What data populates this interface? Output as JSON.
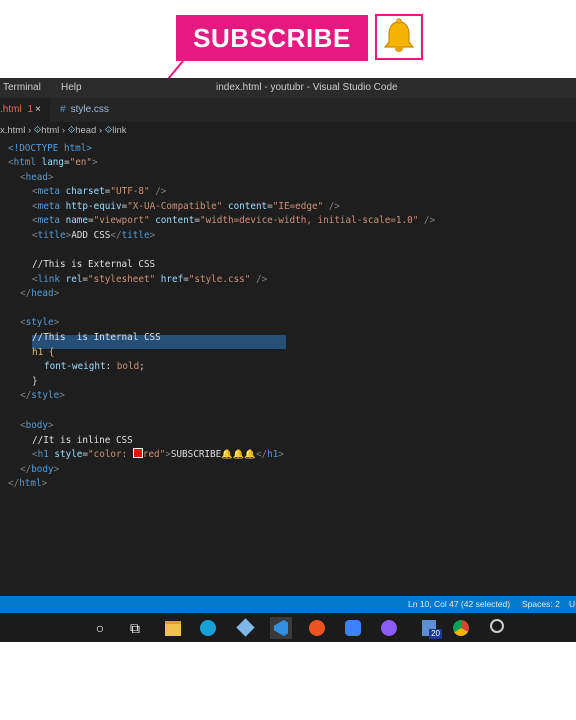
{
  "overlay": {
    "subscribe_label": "SUBSCRIBE",
    "bell_icon": "🔔"
  },
  "window": {
    "menu": [
      "Terminal",
      "Help"
    ],
    "title": "index.html - youtubr - Visual Studio Code"
  },
  "tabs": [
    {
      "label": ".html",
      "badge": "1",
      "close": "×",
      "active": true
    },
    {
      "label": "style.css",
      "prefix": "#",
      "active": false
    }
  ],
  "breadcrumb": [
    "x.html",
    "html",
    "head",
    "link"
  ],
  "code": {
    "doctype": "<!DOCTYPE html>",
    "title_text": "ADD CSS",
    "comment_external": "//This is External CSS",
    "comment_internal": "//This  is Internal CSS",
    "css_selector": "h1 {",
    "css_property": "font-weight",
    "css_value": "bold",
    "comment_inline": "//It is inline CSS",
    "h1_color": "red",
    "h1_text": "SUBSCRIBE🔔🔔🔔"
  },
  "status": {
    "position": "Ln 10, Col 47 (42 selected)",
    "spaces": "Spaces: 2",
    "encoding": "U"
  },
  "taskbar": {
    "items": [
      "search-icon",
      "task-view-icon",
      "file-explorer-icon",
      "edge-icon",
      "3d-viewer-icon",
      "vscode-icon",
      "ubuntu-icon",
      "app-icon",
      "github-icon",
      "calendar-icon",
      "chrome-icon",
      "settings-icon"
    ],
    "calendar_badge": "20"
  },
  "colors": {
    "accent": "#e6197f",
    "statusbar": "#007acc",
    "editor_bg": "#1e1e1e"
  }
}
